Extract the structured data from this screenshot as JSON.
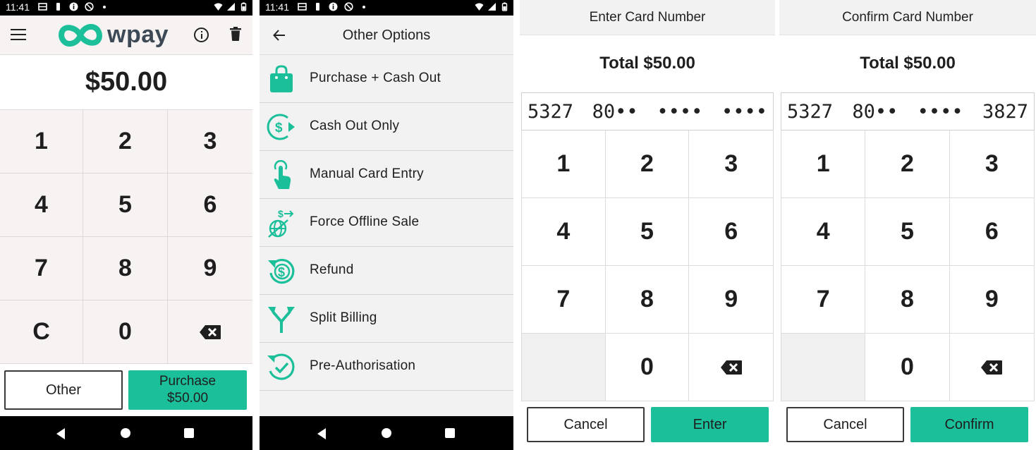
{
  "colors": {
    "accent": "#1bbf9a",
    "text": "#1e1e1e"
  },
  "status_bar": {
    "time": "11:41"
  },
  "screen1": {
    "logo_text": "wpay",
    "amount": "$50.00",
    "keys": [
      "1",
      "2",
      "3",
      "4",
      "5",
      "6",
      "7",
      "8",
      "9",
      "C",
      "0",
      "backspace-icon"
    ],
    "other_label": "Other",
    "purchase_label_line1": "Purchase",
    "purchase_label_line2": "$50.00"
  },
  "screen2": {
    "title": "Other Options",
    "options": [
      {
        "icon": "shopping-bag-icon",
        "label": "Purchase + Cash Out"
      },
      {
        "icon": "cash-out-icon",
        "label": "Cash Out Only"
      },
      {
        "icon": "tap-finger-icon",
        "label": "Manual Card Entry"
      },
      {
        "icon": "offline-globe-icon",
        "label": "Force Offline Sale"
      },
      {
        "icon": "refund-icon",
        "label": "Refund"
      },
      {
        "icon": "split-arrows-icon",
        "label": "Split Billing"
      },
      {
        "icon": "check-clock-icon",
        "label": "Pre-Authorisation"
      }
    ]
  },
  "screen3": {
    "title": "Enter Card Number",
    "total": "Total $50.00",
    "card_groups": [
      "5327",
      "80••",
      "••••",
      "••••"
    ],
    "keys": [
      "1",
      "2",
      "3",
      "4",
      "5",
      "6",
      "7",
      "8",
      "9",
      "",
      "0",
      "backspace-icon"
    ],
    "cancel_label": "Cancel",
    "action_label": "Enter"
  },
  "screen4": {
    "title": "Confirm Card Number",
    "total": "Total $50.00",
    "card_groups": [
      "5327",
      "80••",
      "••••",
      "3827"
    ],
    "keys": [
      "1",
      "2",
      "3",
      "4",
      "5",
      "6",
      "7",
      "8",
      "9",
      "",
      "0",
      "backspace-icon"
    ],
    "cancel_label": "Cancel",
    "action_label": "Confirm"
  }
}
